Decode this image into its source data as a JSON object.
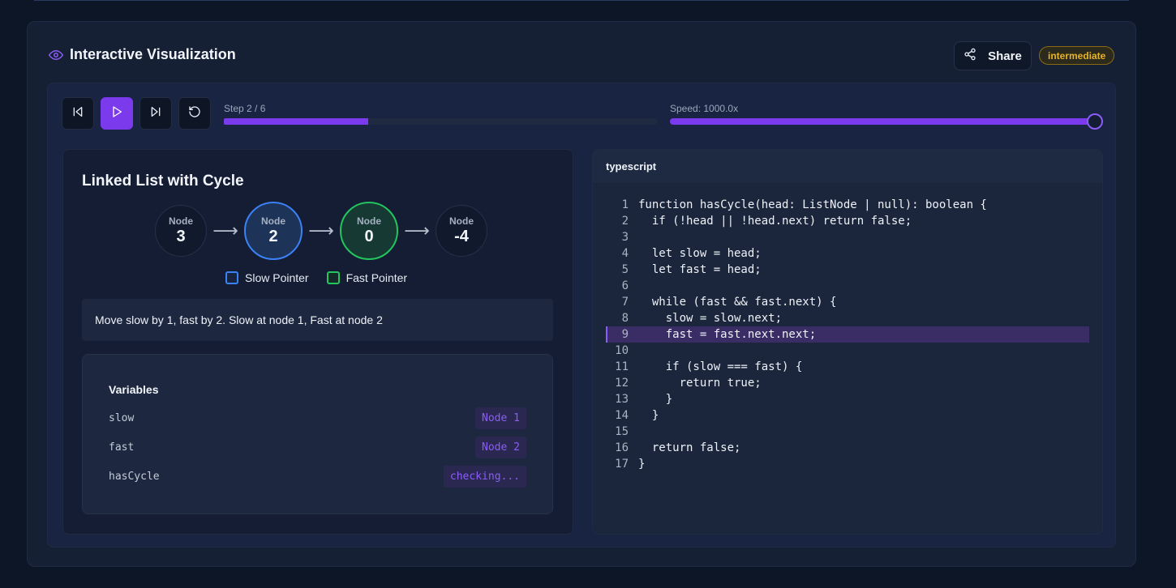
{
  "header": {
    "title": "Interactive Visualization",
    "share_label": "Share",
    "difficulty_badge": "intermediate"
  },
  "controls": {
    "step_label": "Step 2 / 6",
    "step_current": 2,
    "step_total": 6,
    "progress_fraction": 0.333,
    "speed_label": "Speed: 1000.0x",
    "speed_fraction": 1.0
  },
  "visualization": {
    "title": "Linked List with Cycle",
    "nodes": [
      {
        "label": "Node",
        "value": "3",
        "state": "normal"
      },
      {
        "label": "Node",
        "value": "2",
        "state": "slow"
      },
      {
        "label": "Node",
        "value": "0",
        "state": "fast"
      },
      {
        "label": "Node",
        "value": "-4",
        "state": "normal"
      }
    ],
    "arrow_glyph": "⟶",
    "legend": {
      "slow": "Slow Pointer",
      "fast": "Fast Pointer"
    },
    "message": "Move slow by 1, fast by 2. Slow at node 1, Fast at node 2",
    "variables": {
      "title": "Variables",
      "rows": [
        {
          "name": "slow",
          "value": "Node 1"
        },
        {
          "name": "fast",
          "value": "Node 2"
        },
        {
          "name": "hasCycle",
          "value": "checking..."
        }
      ]
    }
  },
  "code": {
    "language": "typescript",
    "active_line": 9,
    "lines": [
      {
        "n": "1",
        "text": "function hasCycle(head: ListNode | null): boolean {"
      },
      {
        "n": "2",
        "text": "  if (!head || !head.next) return false;"
      },
      {
        "n": "3",
        "text": ""
      },
      {
        "n": "4",
        "text": "  let slow = head;"
      },
      {
        "n": "5",
        "text": "  let fast = head;"
      },
      {
        "n": "6",
        "text": ""
      },
      {
        "n": "7",
        "text": "  while (fast && fast.next) {"
      },
      {
        "n": "8",
        "text": "    slow = slow.next;"
      },
      {
        "n": "9",
        "text": "    fast = fast.next.next;"
      },
      {
        "n": "10",
        "text": ""
      },
      {
        "n": "11",
        "text": "    if (slow === fast) {"
      },
      {
        "n": "12",
        "text": "      return true;"
      },
      {
        "n": "13",
        "text": "    }"
      },
      {
        "n": "14",
        "text": "  }"
      },
      {
        "n": "15",
        "text": ""
      },
      {
        "n": "16",
        "text": "  return false;"
      },
      {
        "n": "17",
        "text": "}"
      }
    ]
  },
  "colors": {
    "accent": "#7c3aed",
    "slow": "#3b82f6",
    "fast": "#22c55e",
    "badge": "#e7b428"
  }
}
